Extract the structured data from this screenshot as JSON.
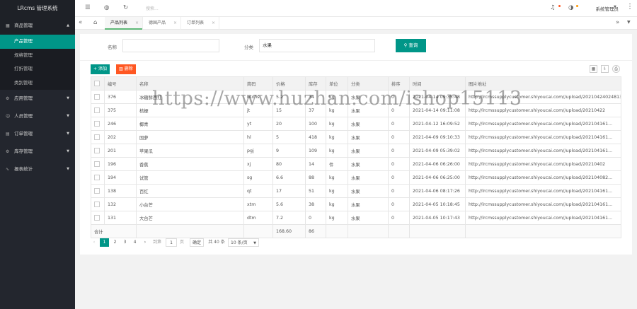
{
  "app": {
    "title": "LRcms 管理系统"
  },
  "sidebar": {
    "groups": [
      {
        "label": "商品管理",
        "icon": "product-icon",
        "open": true,
        "items": [
          {
            "label": "产品管理",
            "active": true
          },
          {
            "label": "规格管理",
            "active": false
          },
          {
            "label": "打折管理",
            "active": false
          },
          {
            "label": "类别管理",
            "active": false
          }
        ]
      },
      {
        "label": "应用管理",
        "icon": "apps-icon"
      },
      {
        "label": "人员管理",
        "icon": "users-icon"
      },
      {
        "label": "订单管理",
        "icon": "orders-icon"
      },
      {
        "label": "库存管理",
        "icon": "stock-icon"
      },
      {
        "label": "报表统计",
        "icon": "report-icon"
      }
    ]
  },
  "topbar": {
    "search_placeholder": "搜索...",
    "admin_name": "系统管理员"
  },
  "tabs": [
    {
      "label": "产品列表",
      "active": true
    },
    {
      "label": "德国产品",
      "active": false
    },
    {
      "label": "订单列表",
      "active": false
    }
  ],
  "filter": {
    "name_label": "名称",
    "name_value": "",
    "category_label": "分类",
    "category_value": "水果",
    "search_button": "查询"
  },
  "toolbar": {
    "add_label": "添加",
    "delete_label": "删除"
  },
  "table": {
    "columns": [
      "编号",
      "名称",
      "简码",
      "价格",
      "库存",
      "单位",
      "分类",
      "排序",
      "时间",
      "图片地址"
    ],
    "rows": [
      [
        "376",
        "冰糖鲜西红",
        "btxhs",
        "5.2",
        "34",
        "kg",
        "水果",
        "0",
        "2021-04-14 09:35:48",
        "http://lrcmssupplycustomer.shiyoucai.com//upload/20210424024813"
      ],
      [
        "375",
        "桔梗",
        "jt",
        "15",
        "37",
        "kg",
        "水果",
        "0",
        "2021-04-14 09:11:08",
        "http://lrcmssupplycustomer.shiyoucai.com//upload/20210422"
      ],
      [
        "246",
        "椰青",
        "yt",
        "20",
        "100",
        "kg",
        "水果",
        "0",
        "2021-04-12 16:09:52",
        "http://lrcmssupplycustomer.shiyoucai.com//upload/202104161..."
      ],
      [
        "202",
        "国萝",
        "hl",
        "5",
        "418",
        "kg",
        "水果",
        "0",
        "2021-04-09 09:10:33",
        "http://lrcmssupplycustomer.shiyoucai.com//upload/202104161..."
      ],
      [
        "201",
        "苹果瓜",
        "pgj",
        "9",
        "109",
        "kg",
        "水果",
        "0",
        "2021-04-09 05:39:02",
        "http://lrcmssupplycustomer.shiyoucai.com//upload/202104161..."
      ],
      [
        "196",
        "香蕉",
        "xj",
        "80",
        "14",
        "件",
        "水果",
        "0",
        "2021-04-06 06:26:00",
        "http://lrcmssupplycustomer.shiyoucai.com//upload/20210402"
      ],
      [
        "194",
        "试管",
        "sg",
        "6.6",
        "88",
        "kg",
        "水果",
        "0",
        "2021-04-06 06:25:00",
        "http://lrcmssupplycustomer.shiyoucai.com//upload/202104082..."
      ],
      [
        "138",
        "百红",
        "qt",
        "17",
        "51",
        "kg",
        "水果",
        "0",
        "2021-04-06 08:17:26",
        "http://lrcmssupplycustomer.shiyoucai.com//upload/202104161..."
      ],
      [
        "132",
        "小台芒",
        "xtm",
        "5.6",
        "38",
        "kg",
        "水果",
        "0",
        "2021-04-05 10:18:45",
        "http://lrcmssupplycustomer.shiyoucai.com//upload/202104161..."
      ],
      [
        "131",
        "大台芒",
        "dtm",
        "7.2",
        "0",
        "kg",
        "水果",
        "0",
        "2021-04-05 10:17:43",
        "http://lrcmssupplycustomer.shiyoucai.com//upload/202104161..."
      ]
    ],
    "total_label": "合计",
    "total_price": "168.60",
    "total_stock": "86"
  },
  "pager": {
    "pages": [
      "1",
      "2",
      "3",
      "4"
    ],
    "current": "1",
    "goto_label": "到第",
    "goto_value": "1",
    "page_unit": "页",
    "confirm": "确定",
    "total_text": "共 40 条",
    "size_text": "10 条/页"
  },
  "watermark": "https://www.huzhan.com/ishop15113",
  "colors": {
    "accent": "#009688",
    "danger": "#ff5722",
    "sidebar": "#23262e"
  }
}
